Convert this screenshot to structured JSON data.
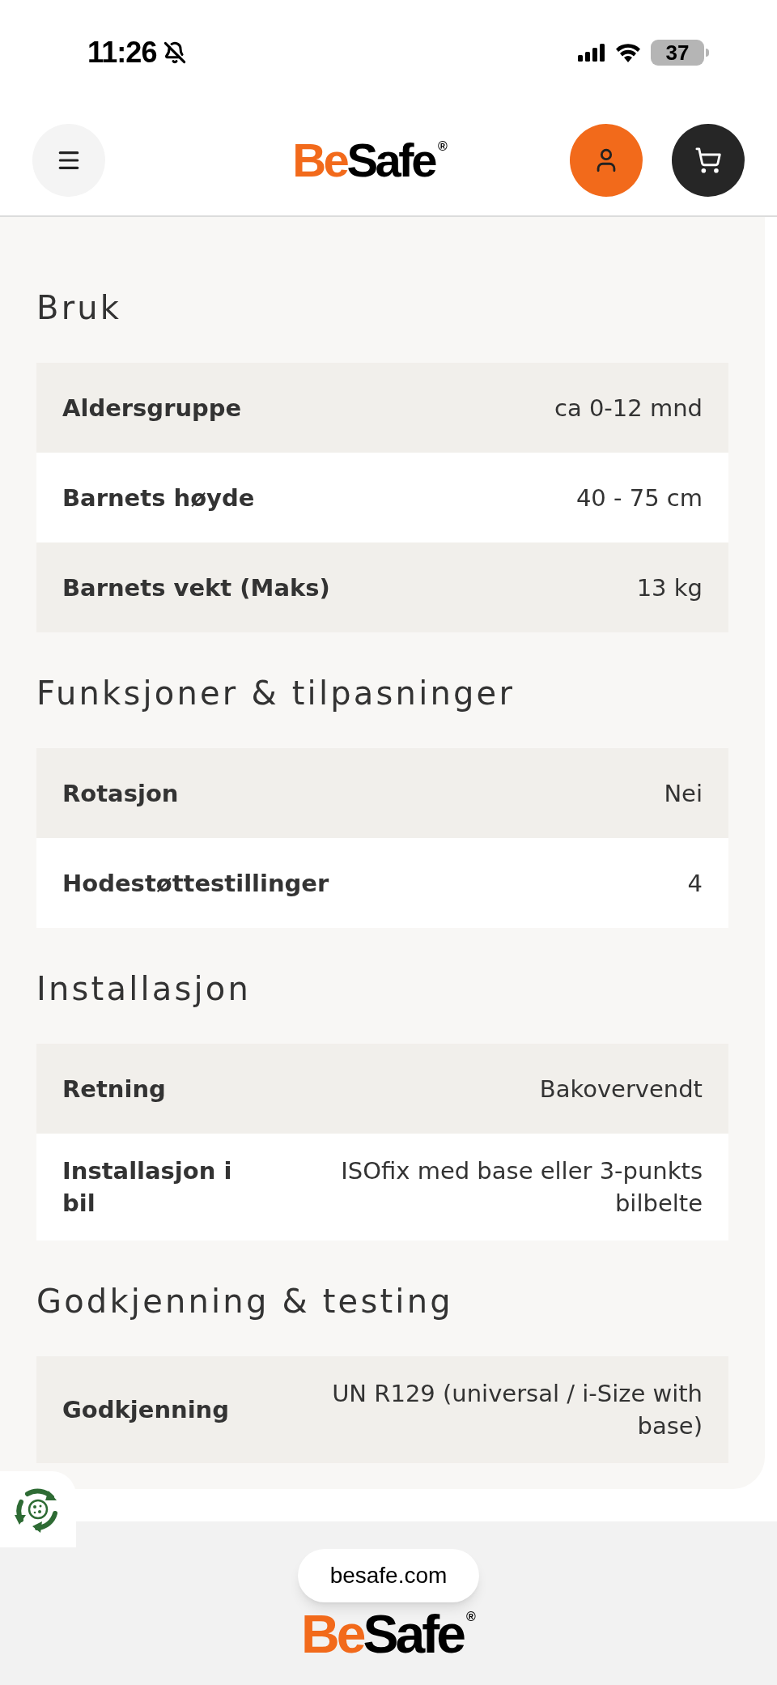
{
  "status_bar": {
    "time": "11:26",
    "battery": "37"
  },
  "header": {
    "logo": {
      "first": "Be",
      "second": "Safe",
      "mark": "®"
    }
  },
  "sections": [
    {
      "title": "Bruk",
      "rows": [
        {
          "label": "Aldersgruppe",
          "value": "ca 0-12 mnd"
        },
        {
          "label": "Barnets høyde",
          "value": "40 - 75 cm"
        },
        {
          "label": "Barnets vekt (Maks)",
          "value": "13 kg"
        }
      ]
    },
    {
      "title": "Funksjoner & tilpasninger",
      "rows": [
        {
          "label": "Rotasjon",
          "value": "Nei"
        },
        {
          "label": "Hodestøttestillinger",
          "value": "4"
        }
      ]
    },
    {
      "title": "Installasjon",
      "rows": [
        {
          "label": "Retning",
          "value": "Bakovervendt"
        },
        {
          "label": "Installasjon i bil",
          "value": "ISOfix med base eller 3-punkts bilbelte"
        }
      ]
    },
    {
      "title": "Godkjenning & testing",
      "rows": [
        {
          "label": "Godkjenning",
          "value": "UN R129 (universal / i-Size with base)"
        }
      ]
    }
  ],
  "footer": {
    "logo": {
      "first": "Be",
      "second": "Safe",
      "mark": "®"
    }
  },
  "url_pill": "besafe.com"
}
